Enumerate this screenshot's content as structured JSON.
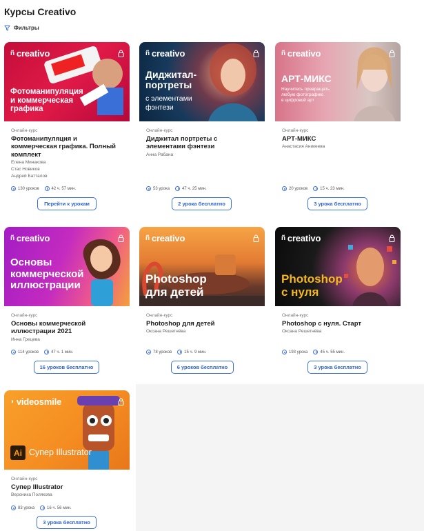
{
  "page": {
    "title": "Курсы Creativo",
    "filters_label": "Фильтры"
  },
  "colors": {
    "accent": "#3d6fd8",
    "background": "#f4f4f5"
  },
  "cards": [
    {
      "brand": "creativo",
      "cover_title_lines": [
        "Фотоманипуляция",
        "и коммерческая",
        "графика"
      ],
      "kind": "Онлайн-курс",
      "name": "Фотоманипуляция и коммерческая графика. Полный комплект",
      "authors": [
        "Елена Минакова",
        "Стас Новиков",
        "Андрей Батталов"
      ],
      "lessons": "130 уроков",
      "duration": "42 ч. 57 мин.",
      "button": "Перейти к урокам"
    },
    {
      "brand": "creativo",
      "cover_title_lines": [
        "Диджитал-",
        "портреты"
      ],
      "cover_sub_lines": [
        "с элементами",
        "фэнтези"
      ],
      "kind": "Онлайн-курс",
      "name": "Диджитал портреты с элементами фэнтези",
      "authors": [
        "Анна Рабана"
      ],
      "lessons": "53 урока",
      "duration": "47 ч. 25 мин.",
      "button": "2 урока бесплатно"
    },
    {
      "brand": "creativo",
      "cover_title_lines": [
        "АРТ-МИКС"
      ],
      "cover_sub_lines": [
        "Научитесь превращать",
        "любую фотографию",
        "в цифровой арт"
      ],
      "kind": "Онлайн-курс",
      "name": "АРТ-МИКС",
      "authors": [
        "Анастасия Аникеева"
      ],
      "lessons": "20 уроков",
      "duration": "15 ч. 23 мин.",
      "button": "3 урока бесплатно"
    },
    {
      "brand": "creativo",
      "cover_title_lines": [
        "Основы",
        "коммерческой",
        "иллюстрации"
      ],
      "kind": "Онлайн-курс",
      "name": "Основы коммерческой иллюстрации 2021",
      "authors": [
        "Инна Грецева"
      ],
      "lessons": "114 уроков",
      "duration": "47 ч. 1 мин.",
      "button": "16 уроков бесплатно"
    },
    {
      "brand": "creativo",
      "cover_title_lines": [
        "Photoshop",
        "для детей"
      ],
      "kind": "Онлайн-курс",
      "name": "Photoshop для детей",
      "authors": [
        "Оксана Решетнёва"
      ],
      "lessons": "78 уроков",
      "duration": "15 ч. 9 мин.",
      "button": "6 уроков бесплатно"
    },
    {
      "brand": "creativo",
      "cover_title_lines": [
        "Photoshop",
        "с нуля"
      ],
      "kind": "Онлайн-курс",
      "name": "Photoshop с нуля. Старт",
      "authors": [
        "Оксана Решетнёва"
      ],
      "lessons": "193 урока",
      "duration": "45 ч. 55 мин.",
      "button": "3 урока бесплатно"
    },
    {
      "brand": "videosmile",
      "cover_title_lines": [
        "Супер Illustrator"
      ],
      "cover_badge": "Ai",
      "kind": "Онлайн-курс",
      "name": "Супер Illustrator",
      "authors": [
        "Вероника Полякова"
      ],
      "lessons": "83 урока",
      "duration": "16 ч. 56 мин.",
      "button": "3 урока бесплатно"
    }
  ]
}
